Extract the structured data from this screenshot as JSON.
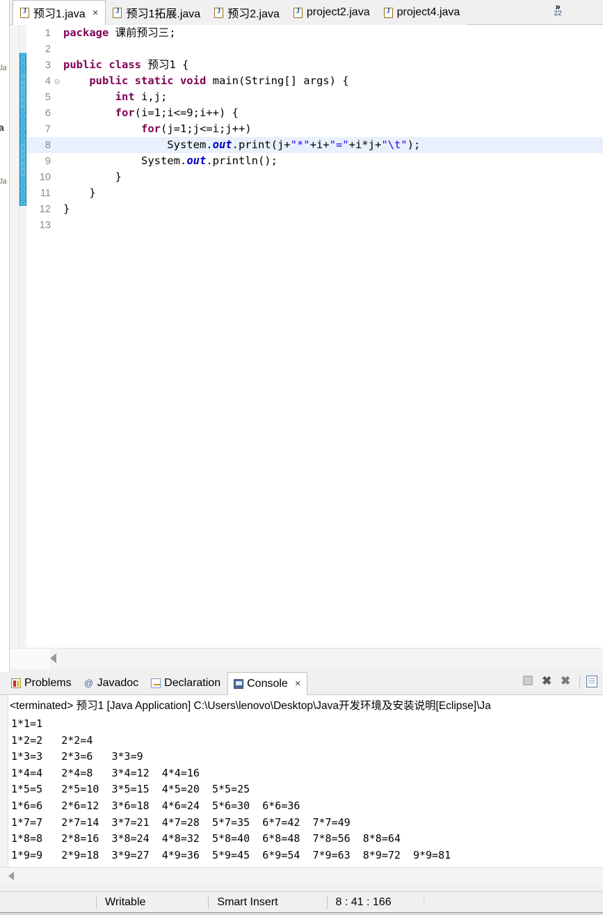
{
  "window": {
    "app": "Eclipse IDE"
  },
  "editor_tabs": {
    "items": [
      {
        "label": "预习1.java",
        "icon": "java-file-icon",
        "active": true,
        "closable": true
      },
      {
        "label": "预习1拓展.java",
        "icon": "java-file-icon",
        "active": false,
        "closable": false
      },
      {
        "label": "预习2.java",
        "icon": "java-file-icon",
        "active": false,
        "closable": false
      },
      {
        "label": "project2.java",
        "icon": "java-file-icon",
        "active": false,
        "closable": false
      },
      {
        "label": "project4.java",
        "icon": "java-file-icon",
        "active": false,
        "closable": false
      }
    ],
    "overflow": {
      "icon": "chevron-double-right-icon",
      "chevron": "»",
      "hidden_count": "22"
    },
    "close_glyph": "×"
  },
  "left_strip": {
    "clipped_labels": [
      "Ja",
      "Ja",
      "a",
      "Ja"
    ]
  },
  "code": {
    "lines": [
      {
        "num": "1",
        "fold": "",
        "highlight": false,
        "tokens": [
          {
            "t": "package",
            "c": "kw"
          },
          {
            "t": " ",
            "c": "cn"
          },
          {
            "t": "课前预习三",
            "c": "pkg"
          },
          {
            "t": ";",
            "c": "cn"
          }
        ]
      },
      {
        "num": "2",
        "fold": "",
        "highlight": false,
        "tokens": []
      },
      {
        "num": "3",
        "fold": "",
        "highlight": false,
        "tokens": [
          {
            "t": "public class ",
            "c": "kw"
          },
          {
            "t": "预习1 {",
            "c": "cn"
          }
        ]
      },
      {
        "num": "4",
        "fold": "⊝",
        "highlight": false,
        "tokens": [
          {
            "t": "    ",
            "c": "cn"
          },
          {
            "t": "public static void ",
            "c": "kw"
          },
          {
            "t": "main(String[] args) {",
            "c": "cn"
          }
        ]
      },
      {
        "num": "5",
        "fold": "",
        "highlight": false,
        "tokens": [
          {
            "t": "        ",
            "c": "cn"
          },
          {
            "t": "int",
            "c": "kw"
          },
          {
            "t": " i,j;",
            "c": "cn"
          }
        ]
      },
      {
        "num": "6",
        "fold": "",
        "highlight": false,
        "tokens": [
          {
            "t": "        ",
            "c": "cn"
          },
          {
            "t": "for",
            "c": "kw"
          },
          {
            "t": "(i=1;i<=9;i++) {",
            "c": "cn"
          }
        ]
      },
      {
        "num": "7",
        "fold": "",
        "highlight": false,
        "tokens": [
          {
            "t": "            ",
            "c": "cn"
          },
          {
            "t": "for",
            "c": "kw"
          },
          {
            "t": "(j=1;j<=i;j++)",
            "c": "cn"
          }
        ]
      },
      {
        "num": "8",
        "fold": "",
        "highlight": true,
        "tokens": [
          {
            "t": "                System.",
            "c": "cn"
          },
          {
            "t": "out",
            "c": "fld"
          },
          {
            "t": ".print(j+",
            "c": "cn"
          },
          {
            "t": "\"*\"",
            "c": "str"
          },
          {
            "t": "+i+",
            "c": "cn"
          },
          {
            "t": "\"=\"",
            "c": "str"
          },
          {
            "t": "+i*j+",
            "c": "cn"
          },
          {
            "t": "\"\\t\"",
            "c": "str"
          },
          {
            "t": ");",
            "c": "cn"
          }
        ]
      },
      {
        "num": "9",
        "fold": "",
        "highlight": false,
        "tokens": [
          {
            "t": "            System.",
            "c": "cn"
          },
          {
            "t": "out",
            "c": "fld"
          },
          {
            "t": ".println();",
            "c": "cn"
          }
        ]
      },
      {
        "num": "10",
        "fold": "",
        "highlight": false,
        "tokens": [
          {
            "t": "        }",
            "c": "cn"
          }
        ]
      },
      {
        "num": "11",
        "fold": "",
        "highlight": false,
        "tokens": [
          {
            "t": "    }",
            "c": "cn"
          }
        ]
      },
      {
        "num": "12",
        "fold": "",
        "highlight": false,
        "tokens": [
          {
            "t": "}",
            "c": "cn"
          }
        ]
      },
      {
        "num": "13",
        "fold": "",
        "highlight": false,
        "tokens": []
      }
    ]
  },
  "view_tabs": {
    "items": [
      {
        "label": "Problems",
        "icon": "problems-icon",
        "active": false,
        "closable": false
      },
      {
        "label": "Javadoc",
        "icon": "javadoc-icon",
        "active": false,
        "closable": false
      },
      {
        "label": "Declaration",
        "icon": "declaration-icon",
        "active": false,
        "closable": false
      },
      {
        "label": "Console",
        "icon": "console-icon",
        "active": true,
        "closable": true
      }
    ],
    "close_glyph": "×",
    "toolbar": [
      {
        "name": "terminate-button",
        "icon": "stop-square-icon"
      },
      {
        "name": "remove-launch-button",
        "icon": "x-icon",
        "glyph": "✖"
      },
      {
        "name": "remove-all-terminated-button",
        "icon": "double-x-icon",
        "glyph": "✖"
      },
      {
        "name": "clear-console-button",
        "icon": "clear-console-icon"
      }
    ]
  },
  "console": {
    "terminated_line": "<terminated> 预习1 [Java Application] C:\\Users\\lenovo\\Desktop\\Java开发环境及安装说明[Eclipse]\\Ja",
    "output": "1*1=1\n1*2=2   2*2=4\n1*3=3   2*3=6   3*3=9\n1*4=4   2*4=8   3*4=12  4*4=16\n1*5=5   2*5=10  3*5=15  4*5=20  5*5=25\n1*6=6   2*6=12  3*6=18  4*6=24  5*6=30  6*6=36\n1*7=7   2*7=14  3*7=21  4*7=28  5*7=35  6*7=42  7*7=49\n1*8=8   2*8=16  3*8=24  4*8=32  5*8=40  6*8=48  7*8=56  8*8=64\n1*9=9   2*9=18  3*9=27  4*9=36  5*9=45  6*9=54  7*9=63  8*9=72  9*9=81"
  },
  "statusbar": {
    "writable": "Writable",
    "insert_mode": "Smart Insert",
    "position": "8 : 41 : 166",
    "dots": "⋮"
  },
  "colors": {
    "keyword": "#7f0055",
    "string": "#2a00ff",
    "field": "#0000c0",
    "highlight_line": "#e8f0fd",
    "fold_cyan": "#1a9fd4",
    "chrome": "#f0f0f0"
  }
}
